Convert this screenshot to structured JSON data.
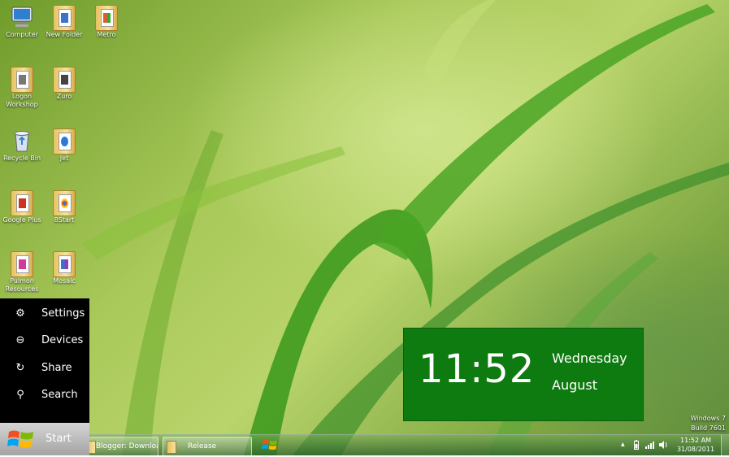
{
  "desktop_icons": [
    {
      "label": "Computer",
      "icon": "computer-icon"
    },
    {
      "label": "New Folder",
      "icon": "folder-icon"
    },
    {
      "label": "Metro",
      "icon": "folder-icon"
    },
    {
      "label": "Logon Workshop",
      "icon": "folder-icon"
    },
    {
      "label": "Zuro",
      "icon": "folder-icon"
    },
    {
      "label": "Recycle Bin",
      "icon": "recycle-bin-icon"
    },
    {
      "label": "Jet",
      "icon": "folder-icon"
    },
    {
      "label": "Google Plus",
      "icon": "folder-icon"
    },
    {
      "label": "8Start",
      "icon": "folder-icon"
    },
    {
      "label": "Pulmon Resources",
      "icon": "folder-icon"
    },
    {
      "label": "Mosaic",
      "icon": "folder-icon"
    }
  ],
  "charms": {
    "items": [
      {
        "label": "Settings",
        "icon": "gear-icon"
      },
      {
        "label": "Devices",
        "icon": "devices-icon"
      },
      {
        "label": "Share",
        "icon": "share-icon"
      },
      {
        "label": "Search",
        "icon": "search-icon"
      }
    ],
    "start_label": "Start"
  },
  "clock_widget": {
    "time": "11:52",
    "day": "Wednesday",
    "month": "August",
    "background": "#0e7b10"
  },
  "watermark": {
    "line1": "Windows 7",
    "line2": "Build 7601"
  },
  "taskbar": {
    "tasks": [
      {
        "label": "Blogger: Downloa..."
      },
      {
        "label": "Release"
      }
    ],
    "tray": {
      "time": "11:52 AM",
      "date": "31/08/2011",
      "show_hidden": "▲"
    }
  }
}
